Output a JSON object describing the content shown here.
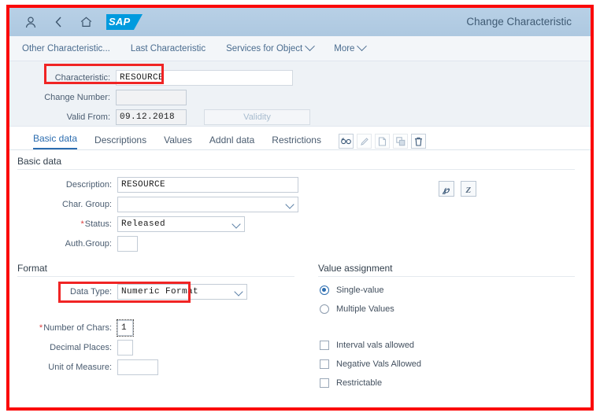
{
  "shell": {
    "title": "Change Characteristic",
    "logo_text": "SAP",
    "icons": [
      {
        "name": "user-icon",
        "glyph": "person"
      },
      {
        "name": "back-icon",
        "glyph": "chevron-left"
      },
      {
        "name": "home-icon",
        "glyph": "home"
      }
    ]
  },
  "action_bar": {
    "items": [
      {
        "label": "Other Characteristic...",
        "has_caret": false
      },
      {
        "label": "Last Characteristic",
        "has_caret": false
      },
      {
        "label": "Services for Object",
        "has_caret": true
      },
      {
        "label": "More",
        "has_caret": true
      }
    ]
  },
  "object_header": {
    "fields": [
      {
        "label": "Characteristic:",
        "value": "RESOURCE"
      },
      {
        "label": "Change Number:",
        "value": ""
      },
      {
        "label": "Valid From:",
        "value": "09.12.2018"
      }
    ],
    "validity_button": "Validity",
    "toolbar_icons": [
      {
        "name": "display-glasses-icon",
        "enabled": true
      },
      {
        "name": "edit-pencil-icon",
        "enabled": false
      },
      {
        "name": "create-page-icon",
        "enabled": false
      },
      {
        "name": "copy-with-reference-icon",
        "enabled": false
      },
      {
        "name": "delete-trash-icon",
        "enabled": true
      }
    ]
  },
  "tabs": [
    {
      "label": "Basic data",
      "active": true
    },
    {
      "label": "Descriptions",
      "active": false
    },
    {
      "label": "Values",
      "active": false
    },
    {
      "label": "Addnl data",
      "active": false
    },
    {
      "label": "Restrictions",
      "active": false
    }
  ],
  "basic_data": {
    "section_title": "Basic data",
    "description": {
      "label": "Description:",
      "value": "RESOURCE"
    },
    "char_group": {
      "label": "Char. Group:",
      "value": ""
    },
    "status": {
      "label": "Status:",
      "value": "Released",
      "required": true
    },
    "auth_group": {
      "label": "Auth.Group:",
      "value": ""
    },
    "side_icons": [
      {
        "name": "translate-icon",
        "glyph": "℘"
      },
      {
        "name": "additional-language-icon",
        "glyph": "Z"
      }
    ]
  },
  "format": {
    "section_title": "Format",
    "data_type": {
      "label": "Data Type:",
      "value": "Numeric Format"
    },
    "number_of_chars": {
      "label": "Number of Chars:",
      "value": "1",
      "required": true
    },
    "decimal_places": {
      "label": "Decimal Places:",
      "value": ""
    },
    "unit_of_measure": {
      "label": "Unit of Measure:",
      "value": ""
    }
  },
  "value_assignment": {
    "section_title": "Value assignment",
    "radios": [
      {
        "label": "Single-value",
        "selected": true
      },
      {
        "label": "Multiple Values",
        "selected": false
      }
    ],
    "checkboxes": [
      {
        "label": "Interval vals allowed",
        "checked": false
      },
      {
        "label": "Negative Vals Allowed",
        "checked": false
      },
      {
        "label": "Restrictable",
        "checked": false
      }
    ]
  },
  "annotations": {
    "highlight_color": "#f02424",
    "frame_color": "#fb0808",
    "boxes": [
      "characteristic-field",
      "data-type-field"
    ]
  }
}
